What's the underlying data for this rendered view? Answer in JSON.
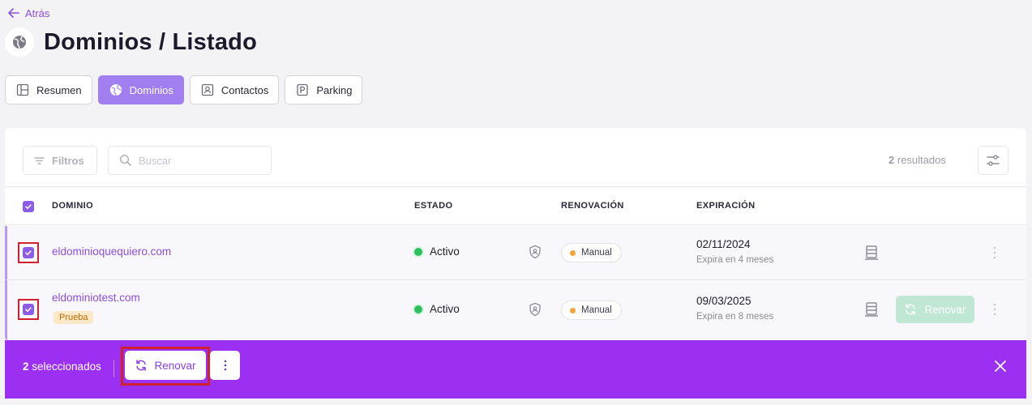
{
  "nav": {
    "back_label": "Atrás"
  },
  "header": {
    "title": "Dominios / Listado",
    "icon": "globe-icon"
  },
  "tabs": [
    {
      "label": "Resumen",
      "icon": "layout-icon",
      "active": false
    },
    {
      "label": "Dominios",
      "icon": "globe-icon",
      "active": true
    },
    {
      "label": "Contactos",
      "icon": "contact-card-icon",
      "active": false
    },
    {
      "label": "Parking",
      "icon": "parking-icon",
      "active": false
    }
  ],
  "toolbar": {
    "filters_label": "Filtros",
    "search_placeholder": "Buscar",
    "results_count": "2",
    "results_label": "resultados"
  },
  "table": {
    "headers": {
      "domain": "DOMINIO",
      "status": "ESTADO",
      "renewal": "RENOVACIÓN",
      "expiration": "EXPIRACIÓN"
    },
    "rows": [
      {
        "domain": "eldominioquequiero.com",
        "tag": "",
        "status": "Activo",
        "renewal": "Manual",
        "exp_date": "02/11/2024",
        "exp_sub": "Expira en 4 meses",
        "renew_button": ""
      },
      {
        "domain": "eldominiotest.com",
        "tag": "Prueba",
        "status": "Activo",
        "renewal": "Manual",
        "exp_date": "09/03/2025",
        "exp_sub": "Expira en 8 meses",
        "renew_button": "Renovar"
      }
    ]
  },
  "bulk": {
    "selected_count": "2",
    "selected_label": "seleccionados",
    "renew_label": "Renovar"
  },
  "colors": {
    "accent": "#8b5ce6",
    "tab_active": "#a27ff0",
    "bulk_bar": "#9b30f2",
    "status_active": "#2ec05f",
    "renewal_manual": "#f3a33a",
    "highlight": "#d0212c"
  }
}
